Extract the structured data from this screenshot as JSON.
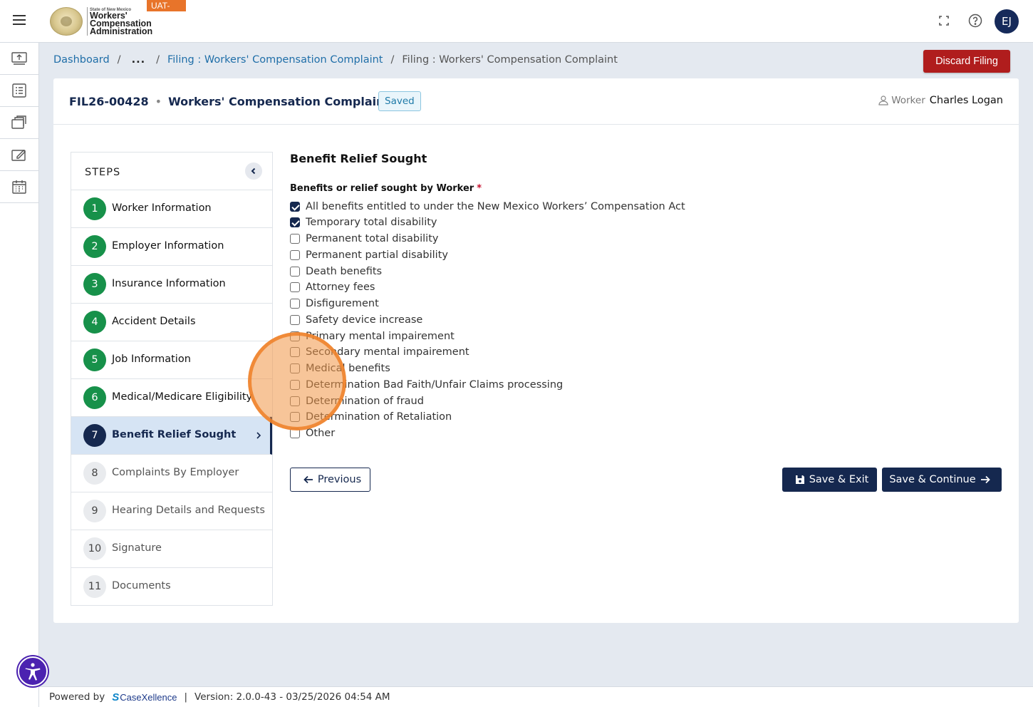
{
  "header": {
    "logo_small_text": "State of New Mexico",
    "logo_lines": [
      "Workers'",
      "Compensation",
      "Administration"
    ],
    "env_badge": "UAT-PUBLIC",
    "avatar_initials": "EJ"
  },
  "breadcrumb": {
    "items": [
      "Dashboard",
      "...",
      "Filing : Workers' Compensation Complaint",
      "Filing : Workers' Compensation Complaint"
    ],
    "separator": "/"
  },
  "actions": {
    "discard_label": "Discard Filing"
  },
  "filing": {
    "id": "FIL26-00428",
    "title": "Workers' Compensation Complaint",
    "status": "Saved",
    "worker_label": "Worker",
    "worker_name": "Charles Logan"
  },
  "steps": {
    "title": "STEPS",
    "items": [
      {
        "num": "1",
        "label": "Worker Information",
        "state": "done"
      },
      {
        "num": "2",
        "label": "Employer Information",
        "state": "done"
      },
      {
        "num": "3",
        "label": "Insurance Information",
        "state": "done"
      },
      {
        "num": "4",
        "label": "Accident Details",
        "state": "done"
      },
      {
        "num": "5",
        "label": "Job Information",
        "state": "done"
      },
      {
        "num": "6",
        "label": "Medical/Medicare Eligibility",
        "state": "done"
      },
      {
        "num": "7",
        "label": "Benefit Relief Sought",
        "state": "active"
      },
      {
        "num": "8",
        "label": "Complaints By Employer",
        "state": "todo"
      },
      {
        "num": "9",
        "label": "Hearing Details and Requests",
        "state": "todo"
      },
      {
        "num": "10",
        "label": "Signature",
        "state": "todo"
      },
      {
        "num": "11",
        "label": "Documents",
        "state": "todo"
      }
    ]
  },
  "form": {
    "section_title": "Benefit Relief Sought",
    "field_label": "Benefits or relief sought by Worker",
    "required_mark": "*",
    "options": [
      {
        "label": "All benefits entitled to under the New Mexico Workers’ Compensation Act",
        "checked": true
      },
      {
        "label": "Temporary total disability",
        "checked": true
      },
      {
        "label": "Permanent total disability",
        "checked": false
      },
      {
        "label": "Permanent partial disability",
        "checked": false
      },
      {
        "label": "Death benefits",
        "checked": false
      },
      {
        "label": "Attorney fees",
        "checked": false
      },
      {
        "label": "Disfigurement",
        "checked": false
      },
      {
        "label": "Safety device increase",
        "checked": false
      },
      {
        "label": "Primary mental impairement",
        "checked": false
      },
      {
        "label": "Secondary mental impairement",
        "checked": false
      },
      {
        "label": "Medical benefits",
        "checked": false
      },
      {
        "label": "Determination Bad Faith/Unfair Claims processing",
        "checked": false
      },
      {
        "label": "Determination of fraud",
        "checked": false
      },
      {
        "label": "Determination of Retaliation",
        "checked": false
      },
      {
        "label": "Other",
        "checked": false
      }
    ],
    "previous_label": "Previous",
    "save_exit_label": "Save & Exit",
    "save_continue_label": "Save & Continue"
  },
  "footer": {
    "powered_by": "Powered by",
    "brand_s": "S",
    "brand_name": "CaseXellence",
    "pipe": "|",
    "version": "Version: 2.0.0-43 - 03/25/2026 04:54 AM"
  },
  "colors": {
    "primary": "#15284f",
    "success": "#17914a",
    "danger": "#b01d1d",
    "env_badge": "#e8742a",
    "accessibility": "#4b22b0"
  }
}
